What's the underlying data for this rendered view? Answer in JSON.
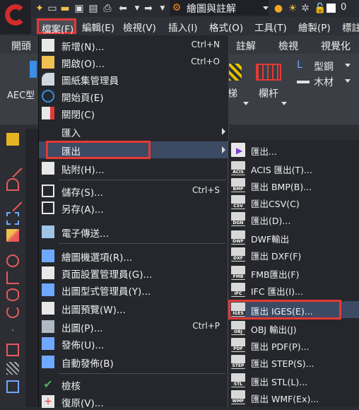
{
  "quick_access": {
    "workspace": "繪圖與註解",
    "counter": "0",
    "icons": [
      "star-icon",
      "new-file-icon",
      "open-folder-icon",
      "save-icon",
      "print-icon",
      "undo-icon",
      "redo-icon",
      "workspace-gear-icon",
      "bulb-icon",
      "sun-icon",
      "lock-icon"
    ]
  },
  "menubar": {
    "file": "檔案(F)",
    "edit": "編輯(E)",
    "view": "檢視(V)",
    "insert": "插入(I)",
    "format": "格式(O)",
    "tools": "工具(T)",
    "draw": "繪製(P)",
    "dimension": "標註"
  },
  "ribbon_tabs": {
    "start": "開頭",
    "annotate": "註解",
    "view": "檢視",
    "visualize": "視覺化"
  },
  "ribbon": {
    "aec": "AEC型",
    "stair": "梯",
    "railing": "欄杆",
    "steel": "型鋼",
    "wood": "木材"
  },
  "file_menu": [
    {
      "label": "新增(N)...",
      "shortcut": "Ctrl+N",
      "icon": "new-document-icon"
    },
    {
      "label": "開啟(O)...",
      "shortcut": "Ctrl+O",
      "icon": "open-document-icon"
    },
    {
      "label": "圖紙集管理員",
      "shortcut": "",
      "icon": "sheet-set-icon"
    },
    {
      "label": "開始頁(E)",
      "shortcut": "",
      "icon": "power-icon"
    },
    {
      "label": "關閉(C)",
      "shortcut": "",
      "icon": "close-document-icon"
    },
    {
      "label": "匯入",
      "shortcut": "",
      "icon": ""
    },
    {
      "label": "匯出",
      "shortcut": "",
      "icon": ""
    },
    {
      "label": "貼附(H)...",
      "shortcut": "",
      "icon": "attach-icon"
    },
    {
      "label": "儲存(S)...",
      "shortcut": "Ctrl+S",
      "icon": "save-icon"
    },
    {
      "label": "另存(A)...",
      "shortcut": "",
      "icon": "save-as-icon"
    },
    {
      "label": "電子傳送...",
      "shortcut": "",
      "icon": "etransmit-icon"
    },
    {
      "label": "繪圖機選項(R)...",
      "shortcut": "",
      "icon": "plotter-icon"
    },
    {
      "label": "頁面設置管理員(G)...",
      "shortcut": "",
      "icon": "page-setup-icon"
    },
    {
      "label": "出圖型式管理員(Y)...",
      "shortcut": "",
      "icon": "plot-style-icon"
    },
    {
      "label": "出圖預覽(W)...",
      "shortcut": "",
      "icon": "plot-preview-icon"
    },
    {
      "label": "出圖(P)...",
      "shortcut": "Ctrl+P",
      "icon": "plot-icon"
    },
    {
      "label": "發佈(U)...",
      "shortcut": "",
      "icon": "publish-icon"
    },
    {
      "label": "自動發佈(B)",
      "shortcut": "",
      "icon": "auto-publish-icon"
    },
    {
      "label": "檢核",
      "shortcut": "",
      "icon": "audit-icon"
    },
    {
      "label": "復原(V)...",
      "shortcut": "",
      "icon": "recover-icon"
    }
  ],
  "export_menu": [
    {
      "label": "匯出...",
      "badge": ""
    },
    {
      "label": "ACIS 匯出(T)...",
      "badge": "ACIS"
    },
    {
      "label": "匯出 BMP(B)...",
      "badge": "BMP"
    },
    {
      "label": "匯出CSV(C)",
      "badge": "CSV"
    },
    {
      "label": "匯出(D)...",
      "badge": "DGN"
    },
    {
      "label": "DWF輸出",
      "badge": "DWF"
    },
    {
      "label": "匯出 DXF(F)",
      "badge": "DXF"
    },
    {
      "label": "FMB匯出(F)",
      "badge": "FMB"
    },
    {
      "label": "IFC 匯出(I)...",
      "badge": "IFC"
    },
    {
      "label": "匯出 IGES(E)...",
      "badge": "IGES"
    },
    {
      "label": "OBJ 輸出(J)",
      "badge": "OBJ"
    },
    {
      "label": "匯出 PDF(P)...",
      "badge": "PDF"
    },
    {
      "label": "匯出 STEP(S)...",
      "badge": "STEP"
    },
    {
      "label": "匯出 STL(L)...",
      "badge": "STL"
    },
    {
      "label": "匯出 WMF(Ex)...",
      "badge": "WMF"
    }
  ],
  "colors": {
    "highlight": "#e53935",
    "menu_bg": "#25272c",
    "hover": "#3c4a63"
  }
}
